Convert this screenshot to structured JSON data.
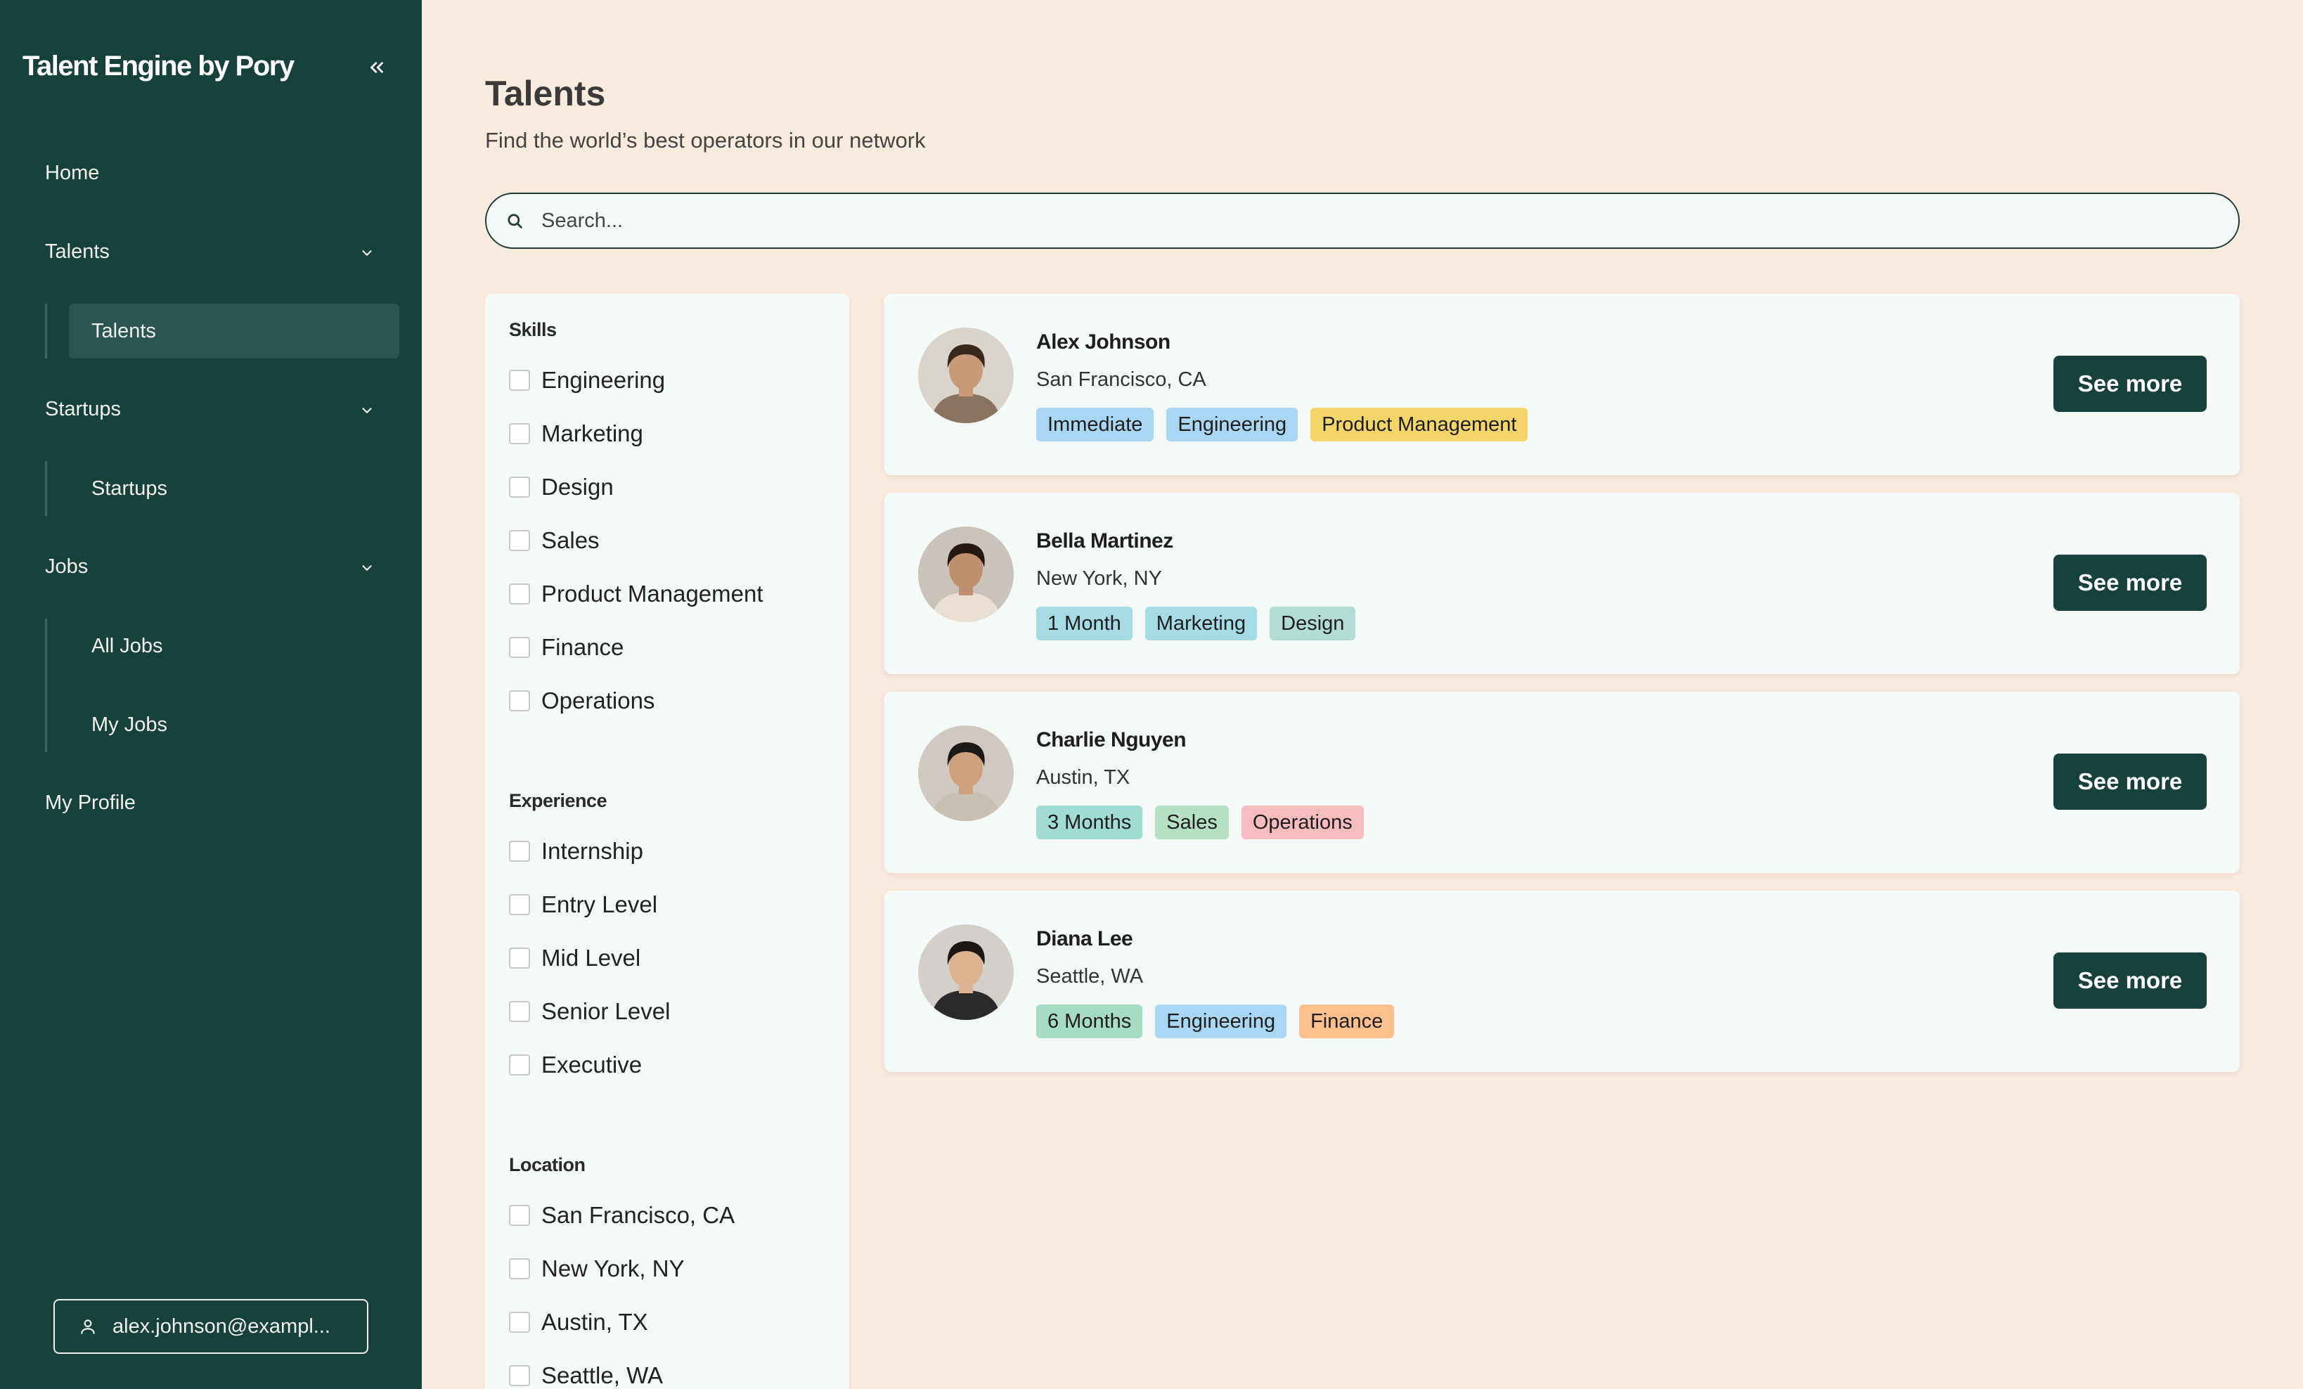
{
  "app": {
    "brand": "Talent Engine by Pory"
  },
  "sidebar": {
    "home": "Home",
    "talents": {
      "label": "Talents",
      "children": [
        "Talents"
      ]
    },
    "startups": {
      "label": "Startups",
      "children": [
        "Startups"
      ]
    },
    "jobs": {
      "label": "Jobs",
      "children": [
        "All Jobs",
        "My Jobs"
      ]
    },
    "profile": "My Profile",
    "user_email": "alex.johnson@exampl..."
  },
  "main": {
    "title": "Talents",
    "subtitle": "Find the world’s best operators in our network",
    "search": {
      "placeholder": "Search...",
      "value": ""
    }
  },
  "filters": {
    "skills": {
      "heading": "Skills",
      "options": [
        "Engineering",
        "Marketing",
        "Design",
        "Sales",
        "Product Management",
        "Finance",
        "Operations"
      ]
    },
    "experience": {
      "heading": "Experience",
      "options": [
        "Internship",
        "Entry Level",
        "Mid Level",
        "Senior Level",
        "Executive"
      ]
    },
    "location": {
      "heading": "Location",
      "options": [
        "San Francisco, CA",
        "New York, NY",
        "Austin, TX",
        "Seattle, WA"
      ]
    }
  },
  "talents": [
    {
      "name": "Alex Johnson",
      "location": "San Francisco, CA",
      "tags": [
        {
          "label": "Immediate",
          "color": "#a9d6f2"
        },
        {
          "label": "Engineering",
          "color": "#a9d6f2"
        },
        {
          "label": "Product Management",
          "color": "#f4d56a"
        }
      ],
      "button": "See more",
      "avatar": {
        "skin": "#c89a78",
        "hair": "#3a281d",
        "shirt": "#8a7460",
        "bg": "#d9d4cc"
      }
    },
    {
      "name": "Bella Martinez",
      "location": "New York, NY",
      "tags": [
        {
          "label": "1 Month",
          "color": "#a4dbe5"
        },
        {
          "label": "Marketing",
          "color": "#a4dbe5"
        },
        {
          "label": "Design",
          "color": "#b1dbd3"
        }
      ],
      "button": "See more",
      "avatar": {
        "skin": "#c28f6e",
        "hair": "#241813",
        "shirt": "#e9e0d3",
        "bg": "#c9c3bb"
      }
    },
    {
      "name": "Charlie Nguyen",
      "location": "Austin, TX",
      "tags": [
        {
          "label": "3 Months",
          "color": "#a0dcd1"
        },
        {
          "label": "Sales",
          "color": "#b6e0c6"
        },
        {
          "label": "Operations",
          "color": "#f6bcc0"
        }
      ],
      "button": "See more",
      "avatar": {
        "skin": "#d0a07c",
        "hair": "#1c1a18",
        "shirt": "#c8c0b2",
        "bg": "#cfc9c1"
      }
    },
    {
      "name": "Diana Lee",
      "location": "Seattle, WA",
      "tags": [
        {
          "label": "6 Months",
          "color": "#a7dcc4"
        },
        {
          "label": "Engineering",
          "color": "#a9d6f2"
        },
        {
          "label": "Finance",
          "color": "#fbc08e"
        }
      ],
      "button": "See more",
      "avatar": {
        "skin": "#dcb391",
        "hair": "#1a1614",
        "shirt": "#2a2a2c",
        "bg": "#d3cfca"
      }
    }
  ]
}
